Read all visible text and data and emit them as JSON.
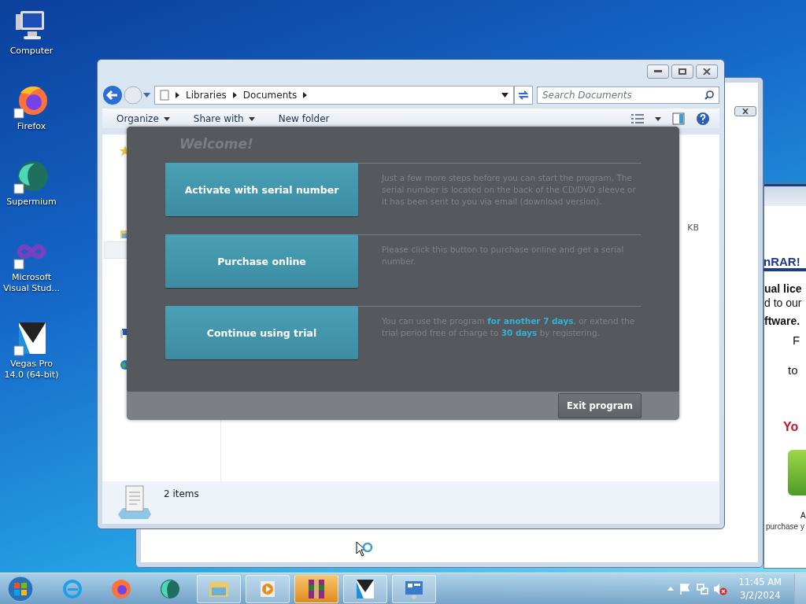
{
  "desktop_icons": [
    {
      "label": "Computer",
      "kind": "computer"
    },
    {
      "label": "Firefox",
      "kind": "firefox"
    },
    {
      "label": "Supermium",
      "kind": "supermium"
    },
    {
      "label": "Microsoft Visual Stud...",
      "kind": "vs"
    },
    {
      "label": "Vegas Pro 14.0 (64-bit)",
      "kind": "vegas"
    }
  ],
  "winrar_window": {
    "lines": [
      {
        "text": "nRAR!",
        "kind": "heading"
      },
      {
        "text": "ual lice",
        "kind": "bold"
      },
      {
        "text": "d to our",
        "kind": "plain"
      },
      {
        "text": "ftware.",
        "kind": "bold"
      },
      {
        "text": "F",
        "kind": "plain"
      },
      {
        "text": "to",
        "kind": "plain"
      },
      {
        "text": "Yo",
        "kind": "red"
      },
      {
        "text": "A",
        "kind": "small"
      },
      {
        "text": "purchase y",
        "kind": "small"
      }
    ]
  },
  "explorer": {
    "breadcrumb": [
      "Libraries",
      "Documents"
    ],
    "search": {
      "placeholder": "Search Documents"
    },
    "toolbar": [
      "Organize",
      "Share with",
      "New folder"
    ],
    "size_fragment": "KB",
    "status": "2 items"
  },
  "dialog": {
    "title": "Welcome!",
    "options": [
      {
        "label": "Activate with serial number",
        "description": "Just a few more steps before you can start the program. The serial number is located on the back of the CD/DVD sleeve or it has been sent to you via email (download version)."
      },
      {
        "label": "Purchase online",
        "description": "Please click this button to purchase online and get a serial number."
      },
      {
        "label": "Continue using trial",
        "description": "You can use the program **for another 7 days**, or extend the trial period free of charge to **30 days** by registering."
      }
    ],
    "exit_button": "Exit program"
  },
  "taskbar": {
    "items": [
      {
        "kind": "ie",
        "open": false
      },
      {
        "kind": "firefox",
        "open": false
      },
      {
        "kind": "supermium",
        "open": false
      },
      {
        "kind": "folder",
        "open": true
      },
      {
        "kind": "media",
        "open": true
      },
      {
        "kind": "winrar",
        "open": true
      },
      {
        "kind": "vegas",
        "open": true
      },
      {
        "kind": "panel",
        "open": true
      }
    ],
    "clock": {
      "time": "11:45 AM",
      "date": "3/2/2024"
    }
  }
}
